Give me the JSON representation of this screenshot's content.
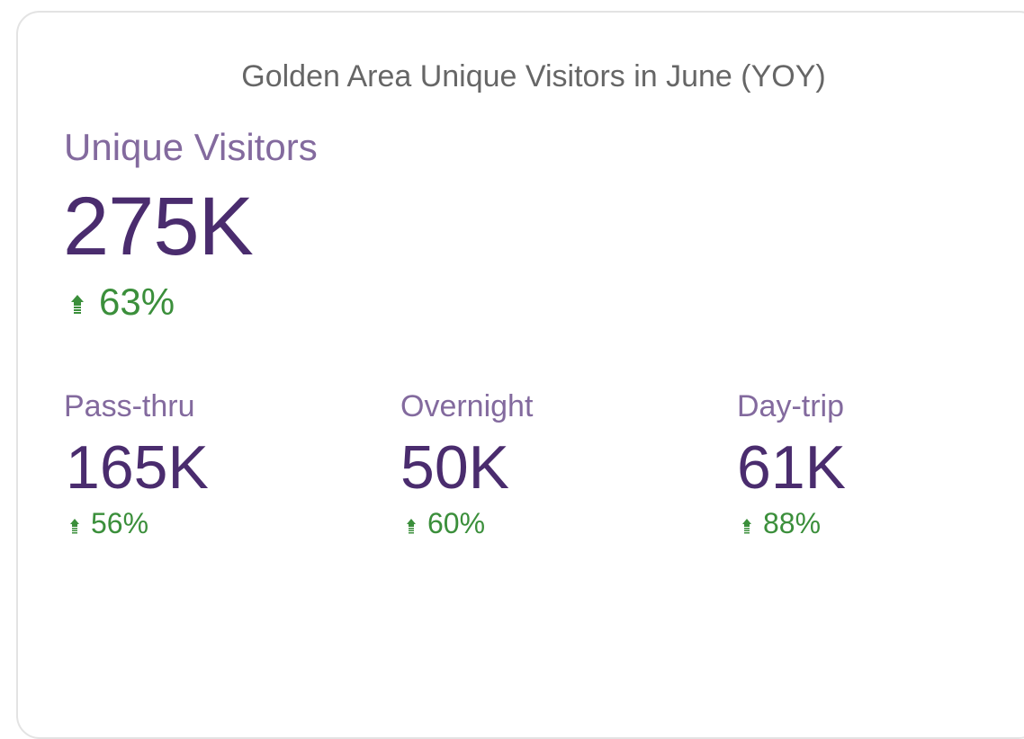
{
  "card": {
    "title": "Golden Area Unique Visitors in June (YOY)"
  },
  "main_metric": {
    "label": "Unique Visitors",
    "value": "275K",
    "change": "63%",
    "trend_icon": "arrow-up-icon"
  },
  "sub_metrics": [
    {
      "label": "Pass-thru",
      "value": "165K",
      "change": "56%",
      "trend_icon": "arrow-up-icon"
    },
    {
      "label": "Overnight",
      "value": "50K",
      "change": "60%",
      "trend_icon": "arrow-up-icon"
    },
    {
      "label": "Day-trip",
      "value": "61K",
      "change": "88%",
      "trend_icon": "arrow-up-icon"
    }
  ],
  "colors": {
    "title": "#666666",
    "label": "#836a9e",
    "value": "#4a2c6e",
    "positive_change": "#3b8f3b",
    "border": "#e3e3e3"
  }
}
